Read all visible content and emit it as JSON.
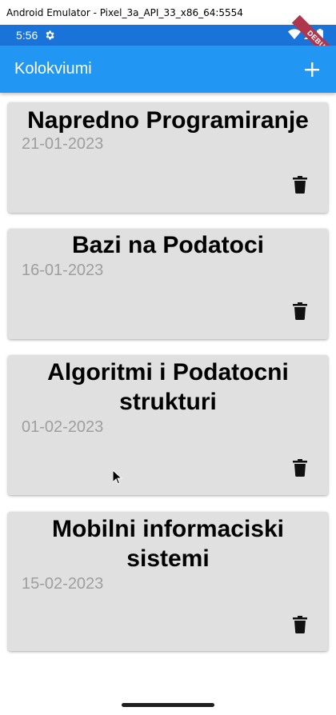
{
  "window": {
    "title": "Android Emulator - Pixel_3a_API_33_x86_64:5554"
  },
  "status_bar": {
    "time": "5:56",
    "ribbon": "DEBUG"
  },
  "app_bar": {
    "title": "Kolokviumi",
    "add_icon": "plus-icon",
    "color": "#2196f3"
  },
  "exams": [
    {
      "name": "Napredno Programiranje",
      "date": "21-01-2023"
    },
    {
      "name": "Bazi na Podatoci",
      "date": "16-01-2023"
    },
    {
      "name": "Algoritmi i Podatocni strukturi",
      "date": "01-02-2023"
    },
    {
      "name": "Mobilni informaciski sistemi",
      "date": "15-02-2023"
    }
  ],
  "colors": {
    "card_bg": "#e0e0e0",
    "date_text": "#9e9e9e",
    "status_bar": "#1a73d9"
  }
}
